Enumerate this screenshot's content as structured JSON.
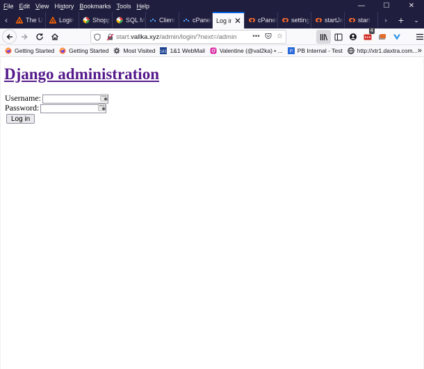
{
  "menu": [
    "File",
    "Edit",
    "View",
    "History",
    "Bookmarks",
    "Tools",
    "Help"
  ],
  "menu_accel": [
    "F",
    "E",
    "V",
    "H",
    "B",
    "T",
    "H"
  ],
  "window_controls": {
    "minimize": "—",
    "maximize": "☐",
    "close": "✕"
  },
  "tabs": [
    {
      "label": "The U",
      "icon": "orange-triangle-icon",
      "color": "#ff6600"
    },
    {
      "label": "Login",
      "icon": "orange-triangle-icon",
      "color": "#ff6600"
    },
    {
      "label": "Shopp",
      "icon": "green-circle-icon",
      "color": "#2fa84f"
    },
    {
      "label": "SQL M",
      "icon": "green-circle-icon",
      "color": "#2fa84f"
    },
    {
      "label": "Client",
      "icon": "blue-dots-icon",
      "color": "#4ea1ff"
    },
    {
      "label": "cPanel",
      "icon": "blue-dots-icon",
      "color": "#4ea1ff"
    },
    {
      "label": "Log in",
      "icon": "",
      "color": "",
      "active": true
    },
    {
      "label": "cPanel",
      "icon": "cpanel-icon",
      "color": "#ff6c2c"
    },
    {
      "label": "setting",
      "icon": "cpanel-icon",
      "color": "#ff6c2c"
    },
    {
      "label": "startJe",
      "icon": "cpanel-icon",
      "color": "#ff6c2c"
    },
    {
      "label": "start",
      "icon": "cpanel-icon",
      "color": "#ff6c2c"
    }
  ],
  "nav": {
    "url_prefix": "start.",
    "url_domain": "vallka.xyz",
    "url_path": "/admin/login/?next=/admin",
    "extension_badge": "4"
  },
  "bookmarks": [
    {
      "label": "Getting Started",
      "icon": "firefox-icon"
    },
    {
      "label": "Getting Started",
      "icon": "firefox-icon"
    },
    {
      "label": "Most Visited",
      "icon": "gear-icon"
    },
    {
      "label": "1&1 WebMail",
      "icon": "1and1-icon"
    },
    {
      "label": "Valentine (@val2ka) • ...",
      "icon": "instagram-icon"
    },
    {
      "label": "PB Internal - Test",
      "icon": "pb-icon"
    },
    {
      "label": "http://xtr1.daxtra.com...",
      "icon": "globe-icon"
    }
  ],
  "page": {
    "title": "Django administration",
    "username_label": "Username:",
    "password_label": "Password:",
    "login_button": "Log in"
  },
  "colors": {
    "titlebar": "#1f1e3e",
    "active_tab_top": "#0060df",
    "link_visited": "#551a8b"
  }
}
